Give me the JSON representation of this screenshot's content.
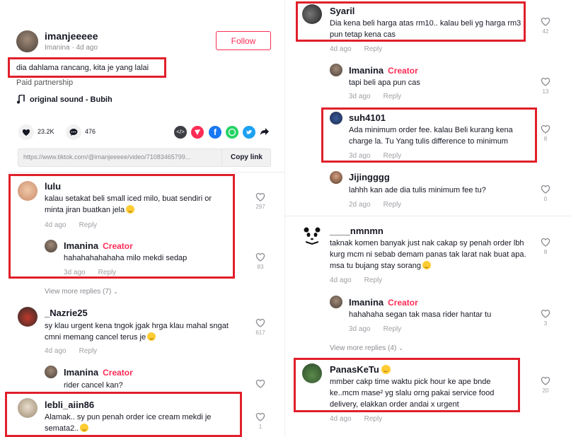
{
  "post": {
    "author": "imanjeeeee",
    "sub": "Imanina · 4d ago",
    "follow_label": "Follow",
    "caption": "dia dahlama rancang, kita je yang lalai",
    "paid": "Paid partnership",
    "sound": "original sound - Bubih",
    "likes": "23.2K",
    "comments": "476",
    "url": "https://www.tiktok.com/@imanjeeeee/video/71083465799...",
    "copy_label": "Copy link"
  },
  "comments_left": [
    {
      "user": "lulu",
      "text": "kalau setakat beli small iced milo, buat sendiri or minta jiran buatkan jela",
      "age": "4d ago",
      "reply": "Reply",
      "likes": "297"
    },
    {
      "user": "Imanina",
      "creator": "Creator",
      "text": "hahahahahahaha milo mekdi sedap",
      "age": "3d ago",
      "reply": "Reply",
      "likes": "83"
    },
    {
      "user": "_Nazrie25",
      "text": "sy klau urgent kena tngok jgak hrga klau mahal sngat cmni memang cancel terus je",
      "age": "4d ago",
      "reply": "Reply",
      "likes": "617"
    },
    {
      "user": "Imanina",
      "creator": "Creator",
      "text": "rider cancel kan?",
      "age": "",
      "reply": "",
      "likes": ""
    },
    {
      "user": "lebli_aiin86",
      "text": "Alamak.. sy pun penah order ice cream mekdi je semata2..",
      "age": "",
      "reply": "",
      "likes": "1"
    }
  ],
  "view_more_left": "View more replies (7)",
  "comments_right": [
    {
      "user": "Syaril",
      "text": "Dia kena beli harga atas rm10.. kalau beli yg harga rm3 pun tetap kena cas",
      "age": "4d ago",
      "reply": "Reply",
      "likes": "42"
    },
    {
      "user": "Imanina",
      "creator": "Creator",
      "text": "tapi beli apa pun cas",
      "age": "3d ago",
      "reply": "Reply",
      "likes": "13"
    },
    {
      "user": "suh4101",
      "text": "Ada minimum order fee. kalau Beli kurang kena charge la. Tu Yang tulis difference to minimum",
      "age": "3d ago",
      "reply": "Reply",
      "likes": "8"
    },
    {
      "user": "Jijingggg",
      "text": "lahhh kan ade dia tulis minimum fee tu?",
      "age": "2d ago",
      "reply": "Reply",
      "likes": "0"
    },
    {
      "user": "____nmnmn",
      "text": "taknak komen banyak just nak cakap sy penah order lbh kurg mcm ni sebab demam panas tak larat nak buat apa. msa tu bujang stay sorang",
      "age": "4d ago",
      "reply": "Reply",
      "likes": "8"
    },
    {
      "user": "Imanina",
      "creator": "Creator",
      "text": "hahahaha segan tak masa rider hantar tu",
      "age": "3d ago",
      "reply": "Reply",
      "likes": "3"
    },
    {
      "user": "PanasKeTu",
      "text": "mmber cakp time waktu pick hour ke ape bnde ke..mcm mase² yg slalu orng pakai service food delivery, elakkan order andai x urgent",
      "age": "4d ago",
      "reply": "Reply",
      "likes": "20"
    }
  ],
  "view_more_right": "View more replies (4)",
  "colors": {
    "accent": "#fe2c55",
    "highlight": "#e0202b"
  }
}
